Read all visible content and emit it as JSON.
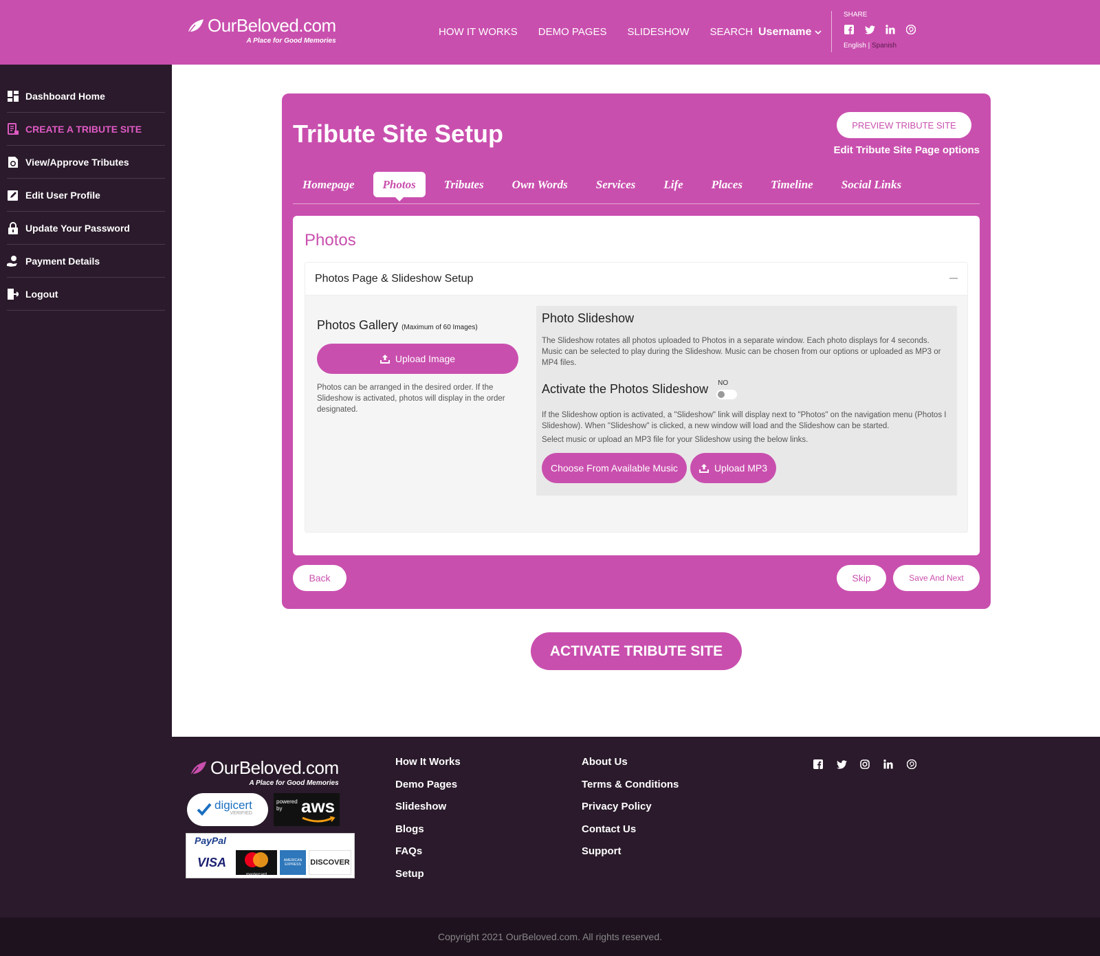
{
  "brand": {
    "name": "OurBeloved.com",
    "tagline": "A Place for Good Memories",
    "color": "#c94fae"
  },
  "topnav": {
    "items": [
      "HOW IT WORKS",
      "DEMO PAGES",
      "SLIDESHOW",
      "SEARCH"
    ],
    "username": "Username"
  },
  "share": {
    "label": "SHARE",
    "icons": [
      "facebook-icon",
      "twitter-icon",
      "linkedin-icon",
      "pinterest-icon"
    ],
    "lang_en": "English |",
    "lang_es": " Spanish"
  },
  "sidebar": {
    "items": [
      {
        "label": "Dashboard Home",
        "icon": "dashboard-icon"
      },
      {
        "label": "CREATE A TRIBUTE SITE",
        "icon": "create-icon"
      },
      {
        "label": "View/Approve Tributes",
        "icon": "tributes-icon"
      },
      {
        "label": "Edit User Profile",
        "icon": "edit-icon"
      },
      {
        "label": "Update Your Password",
        "icon": "lock-icon"
      },
      {
        "label": "Payment Details",
        "icon": "payment-icon"
      },
      {
        "label": "Logout",
        "icon": "logout-icon"
      }
    ]
  },
  "setup": {
    "title": "Tribute Site Setup",
    "preview_label": "PREVIEW TRIBUTE SITE",
    "edit_options": "Edit Tribute Site Page options",
    "tabs": [
      "Homepage",
      "Photos",
      "Tributes",
      "Own Words",
      "Services",
      "Life",
      "Places",
      "Timeline",
      "Social Links"
    ],
    "active_tab": "Photos"
  },
  "photos": {
    "title": "Photos",
    "section_head": "Photos Page & Slideshow Setup",
    "gallery_title": "Photos Gallery",
    "gallery_max": "(Maximum of 60 Images)",
    "upload_image": "Upload Image",
    "gallery_text": "Photos can be arranged in the desired order. If the Slideshow is activated, photos will display in the order designated.",
    "slideshow_title": "Photo Slideshow",
    "slideshow_desc": "The Slideshow rotates all photos uploaded to Photos in a separate window. Each photo displays for 4 seconds. Music can be selected to play during the Slideshow. Music can be chosen from our options or uploaded as MP3 or MP4 files.",
    "activate_label": "Activate the Photos Slideshow",
    "toggle_state": "NO",
    "slideshow_note": "If the Slideshow option is activated, a \"Slideshow\" link will display next to \"Photos\" on the navigation menu (Photos I Slideshow). When \"Slideshow\" is clicked, a new window will load and the Slideshow can be started.",
    "slideshow_note2": "Select music or upload an MP3 file for your Slideshow using the below links.",
    "choose_music": "Choose From Available Music",
    "upload_mp3": "Upload MP3"
  },
  "actions": {
    "back": "Back",
    "skip": "Skip",
    "save_next": "Save And Next",
    "activate": "ACTIVATE TRIBUTE SITE"
  },
  "footer": {
    "col1": [
      "How It Works",
      "Demo Pages",
      "Slideshow",
      "Blogs",
      "FAQs",
      "Setup"
    ],
    "col2": [
      "About Us",
      "Terms & Conditions",
      "Privacy Policy",
      "Contact Us",
      "Support"
    ],
    "social_icons": [
      "facebook-icon",
      "twitter-icon",
      "instagram-icon",
      "linkedin-icon",
      "pinterest-icon"
    ],
    "digicert": "digicert",
    "digicert_sub": "VERIFIED",
    "aws_powered": "powered by",
    "aws": "aws",
    "paypal": "PayPal",
    "card_brands": [
      "VISA",
      "mastercard",
      "AMERICAN EXPRESS",
      "DISCOVER"
    ],
    "copyright": "Copyright 2021 OurBeloved.com. All rights reserved."
  }
}
